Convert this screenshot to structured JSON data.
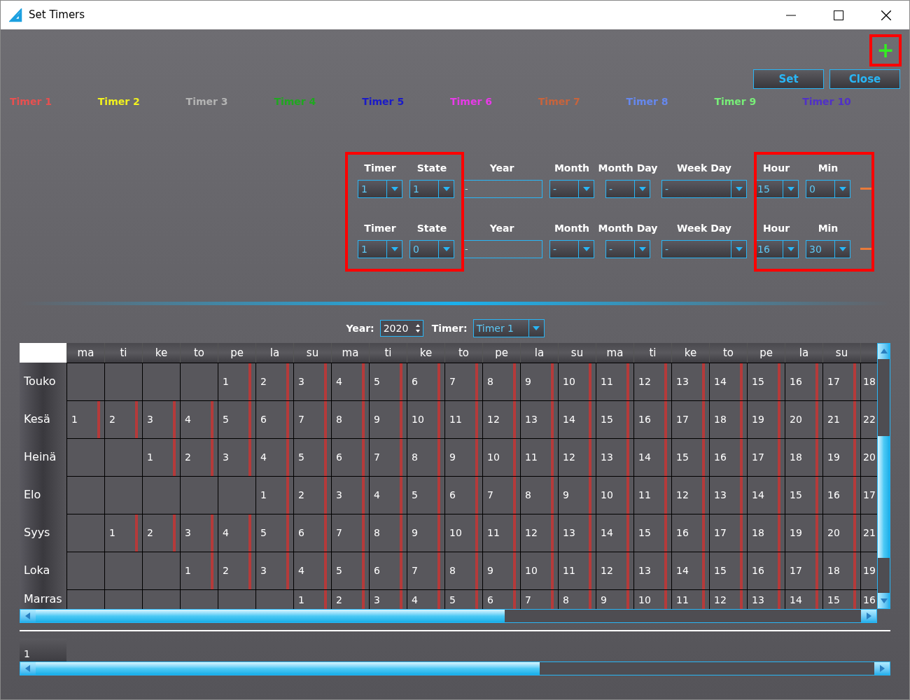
{
  "window": {
    "title": "Set Timers"
  },
  "toolbar": {
    "add_label": "+",
    "buttons": [
      "Set",
      "Close"
    ]
  },
  "legend": [
    {
      "label": "Timer 1",
      "color": "#e85050"
    },
    {
      "label": "Timer 2",
      "color": "#f2f21e"
    },
    {
      "label": "Timer 3",
      "color": "#b4b4b4"
    },
    {
      "label": "Timer 4",
      "color": "#1fa81f"
    },
    {
      "label": "Timer 5",
      "color": "#1a1ac8"
    },
    {
      "label": "Timer 6",
      "color": "#e83ae8"
    },
    {
      "label": "Timer 7",
      "color": "#c8643c"
    },
    {
      "label": "Timer 8",
      "color": "#6688ee"
    },
    {
      "label": "Timer 9",
      "color": "#78ee78"
    },
    {
      "label": "Timer 10",
      "color": "#5030c8"
    }
  ],
  "timer_rows": [
    {
      "fields": [
        {
          "label": "Timer",
          "kind": "select",
          "value": "1"
        },
        {
          "label": "State",
          "kind": "select",
          "value": "1"
        },
        {
          "label": "Year",
          "kind": "text",
          "value": "-"
        },
        {
          "label": "Month",
          "kind": "select",
          "value": "-"
        },
        {
          "label": "Month Day",
          "kind": "select",
          "value": "-"
        },
        {
          "label": "Week Day",
          "kind": "wide",
          "value": "-"
        },
        {
          "label": "Hour",
          "kind": "select",
          "value": "15"
        },
        {
          "label": "Min",
          "kind": "select",
          "value": "0"
        }
      ]
    },
    {
      "fields": [
        {
          "label": "Timer",
          "kind": "select",
          "value": "1"
        },
        {
          "label": "State",
          "kind": "select",
          "value": "0"
        },
        {
          "label": "Year",
          "kind": "text",
          "value": "-"
        },
        {
          "label": "Month",
          "kind": "select",
          "value": "-"
        },
        {
          "label": "Month Day",
          "kind": "select",
          "value": "-"
        },
        {
          "label": "Week Day",
          "kind": "wide",
          "value": "-"
        },
        {
          "label": "Hour",
          "kind": "select",
          "value": "16"
        },
        {
          "label": "Min",
          "kind": "select",
          "value": "30"
        }
      ]
    }
  ],
  "calendar_filter": {
    "year_label": "Year:",
    "year": "2020",
    "timer_label": "Timer:",
    "timer": "Timer 1"
  },
  "calendar": {
    "weekdays": [
      "ma",
      "ti",
      "ke",
      "to",
      "pe",
      "la",
      "su",
      "ma",
      "ti",
      "ke",
      "to",
      "pe",
      "la",
      "su",
      "ma",
      "ti",
      "ke",
      "to",
      "pe",
      "la",
      "su"
    ],
    "rows": [
      {
        "month": "Touko",
        "cells": [
          {
            "kind": "blank"
          },
          {
            "kind": "blank"
          },
          {
            "kind": "blank"
          },
          {
            "kind": "blank"
          },
          {
            "kind": "day",
            "day": "1"
          },
          {
            "kind": "day",
            "day": "2"
          },
          {
            "kind": "day",
            "day": "3"
          },
          {
            "kind": "day",
            "day": "4"
          },
          {
            "kind": "day",
            "day": "5"
          },
          {
            "kind": "day",
            "day": "6"
          },
          {
            "kind": "day",
            "day": "7"
          },
          {
            "kind": "day",
            "day": "8"
          },
          {
            "kind": "day",
            "day": "9"
          },
          {
            "kind": "day",
            "day": "10"
          },
          {
            "kind": "day",
            "day": "11"
          },
          {
            "kind": "day",
            "day": "12"
          },
          {
            "kind": "day",
            "day": "13"
          },
          {
            "kind": "day",
            "day": "14"
          },
          {
            "kind": "day",
            "day": "15"
          },
          {
            "kind": "day",
            "day": "16"
          },
          {
            "kind": "day",
            "day": "17"
          },
          {
            "kind": "day",
            "day": "18"
          }
        ]
      },
      {
        "month": "Kesä",
        "cells": [
          {
            "kind": "day",
            "day": "1"
          },
          {
            "kind": "day",
            "day": "2"
          },
          {
            "kind": "day",
            "day": "3"
          },
          {
            "kind": "day",
            "day": "4"
          },
          {
            "kind": "day",
            "day": "5"
          },
          {
            "kind": "day",
            "day": "6"
          },
          {
            "kind": "day",
            "day": "7"
          },
          {
            "kind": "day",
            "day": "8"
          },
          {
            "kind": "day",
            "day": "9"
          },
          {
            "kind": "day",
            "day": "10"
          },
          {
            "kind": "day",
            "day": "11"
          },
          {
            "kind": "day",
            "day": "12"
          },
          {
            "kind": "day",
            "day": "13"
          },
          {
            "kind": "day",
            "day": "14"
          },
          {
            "kind": "day",
            "day": "15"
          },
          {
            "kind": "day",
            "day": "16"
          },
          {
            "kind": "day",
            "day": "17"
          },
          {
            "kind": "day",
            "day": "18"
          },
          {
            "kind": "day",
            "day": "19"
          },
          {
            "kind": "day",
            "day": "20"
          },
          {
            "kind": "day",
            "day": "21"
          },
          {
            "kind": "day",
            "day": "22"
          }
        ]
      },
      {
        "month": "Heinä",
        "cells": [
          {
            "kind": "blank"
          },
          {
            "kind": "blank"
          },
          {
            "kind": "day",
            "day": "1"
          },
          {
            "kind": "day",
            "day": "2"
          },
          {
            "kind": "day",
            "day": "3"
          },
          {
            "kind": "day",
            "day": "4"
          },
          {
            "kind": "day",
            "day": "5"
          },
          {
            "kind": "day",
            "day": "6"
          },
          {
            "kind": "day",
            "day": "7"
          },
          {
            "kind": "day",
            "day": "8"
          },
          {
            "kind": "day",
            "day": "9"
          },
          {
            "kind": "day",
            "day": "10"
          },
          {
            "kind": "day",
            "day": "11"
          },
          {
            "kind": "day",
            "day": "12"
          },
          {
            "kind": "day",
            "day": "13"
          },
          {
            "kind": "day",
            "day": "14"
          },
          {
            "kind": "day",
            "day": "15"
          },
          {
            "kind": "day",
            "day": "16"
          },
          {
            "kind": "day",
            "day": "17"
          },
          {
            "kind": "day",
            "day": "18"
          },
          {
            "kind": "day",
            "day": "19"
          },
          {
            "kind": "day",
            "day": "20"
          }
        ]
      },
      {
        "month": "Elo",
        "cells": [
          {
            "kind": "blank"
          },
          {
            "kind": "blank"
          },
          {
            "kind": "blank"
          },
          {
            "kind": "blank"
          },
          {
            "kind": "blank"
          },
          {
            "kind": "day",
            "day": "1"
          },
          {
            "kind": "day",
            "day": "2"
          },
          {
            "kind": "day",
            "day": "3"
          },
          {
            "kind": "day",
            "day": "4"
          },
          {
            "kind": "day",
            "day": "5"
          },
          {
            "kind": "day",
            "day": "6"
          },
          {
            "kind": "day",
            "day": "7"
          },
          {
            "kind": "day",
            "day": "8"
          },
          {
            "kind": "day",
            "day": "9"
          },
          {
            "kind": "day",
            "day": "10"
          },
          {
            "kind": "day",
            "day": "11"
          },
          {
            "kind": "day",
            "day": "12"
          },
          {
            "kind": "day",
            "day": "13"
          },
          {
            "kind": "day",
            "day": "14"
          },
          {
            "kind": "day",
            "day": "15"
          },
          {
            "kind": "day",
            "day": "16"
          },
          {
            "kind": "day",
            "day": "17"
          }
        ]
      },
      {
        "month": "Syys",
        "cells": [
          {
            "kind": "blank"
          },
          {
            "kind": "day",
            "day": "1"
          },
          {
            "kind": "day",
            "day": "2"
          },
          {
            "kind": "day",
            "day": "3"
          },
          {
            "kind": "day",
            "day": "4"
          },
          {
            "kind": "day",
            "day": "5"
          },
          {
            "kind": "day",
            "day": "6"
          },
          {
            "kind": "day",
            "day": "7"
          },
          {
            "kind": "day",
            "day": "8"
          },
          {
            "kind": "day",
            "day": "9"
          },
          {
            "kind": "day",
            "day": "10"
          },
          {
            "kind": "day",
            "day": "11"
          },
          {
            "kind": "day",
            "day": "12"
          },
          {
            "kind": "day",
            "day": "13"
          },
          {
            "kind": "day",
            "day": "14"
          },
          {
            "kind": "day",
            "day": "15"
          },
          {
            "kind": "day",
            "day": "16"
          },
          {
            "kind": "day",
            "day": "17"
          },
          {
            "kind": "day",
            "day": "18"
          },
          {
            "kind": "day",
            "day": "19"
          },
          {
            "kind": "day",
            "day": "20"
          },
          {
            "kind": "day",
            "day": "21"
          }
        ]
      },
      {
        "month": "Loka",
        "cells": [
          {
            "kind": "blank"
          },
          {
            "kind": "blank"
          },
          {
            "kind": "blank"
          },
          {
            "kind": "day",
            "day": "1"
          },
          {
            "kind": "day",
            "day": "2"
          },
          {
            "kind": "day",
            "day": "3"
          },
          {
            "kind": "day",
            "day": "4"
          },
          {
            "kind": "day",
            "day": "5"
          },
          {
            "kind": "day",
            "day": "6"
          },
          {
            "kind": "day",
            "day": "7"
          },
          {
            "kind": "day",
            "day": "8"
          },
          {
            "kind": "day",
            "day": "9"
          },
          {
            "kind": "day",
            "day": "10"
          },
          {
            "kind": "day",
            "day": "11"
          },
          {
            "kind": "day",
            "day": "12"
          },
          {
            "kind": "day",
            "day": "13"
          },
          {
            "kind": "day",
            "day": "14"
          },
          {
            "kind": "day",
            "day": "15"
          },
          {
            "kind": "day",
            "day": "16"
          },
          {
            "kind": "day",
            "day": "17"
          },
          {
            "kind": "day",
            "day": "18"
          },
          {
            "kind": "day",
            "day": "19"
          }
        ]
      },
      {
        "month": "Marras",
        "cells": [
          {
            "kind": "blank"
          },
          {
            "kind": "blank"
          },
          {
            "kind": "blank"
          },
          {
            "kind": "blank"
          },
          {
            "kind": "blank"
          },
          {
            "kind": "blank"
          },
          {
            "kind": "day",
            "day": "1"
          },
          {
            "kind": "day",
            "day": "2"
          },
          {
            "kind": "day",
            "day": "3"
          },
          {
            "kind": "day",
            "day": "4"
          },
          {
            "kind": "day",
            "day": "5"
          },
          {
            "kind": "day",
            "day": "6"
          },
          {
            "kind": "day",
            "day": "7"
          },
          {
            "kind": "day",
            "day": "8"
          },
          {
            "kind": "day",
            "day": "9"
          },
          {
            "kind": "day",
            "day": "10"
          },
          {
            "kind": "day",
            "day": "11"
          },
          {
            "kind": "day",
            "day": "12"
          },
          {
            "kind": "day",
            "day": "13"
          },
          {
            "kind": "day",
            "day": "14"
          },
          {
            "kind": "day",
            "day": "15"
          },
          {
            "kind": "day",
            "day": "16"
          }
        ]
      }
    ]
  },
  "summary": {
    "rows": [
      "1"
    ]
  }
}
